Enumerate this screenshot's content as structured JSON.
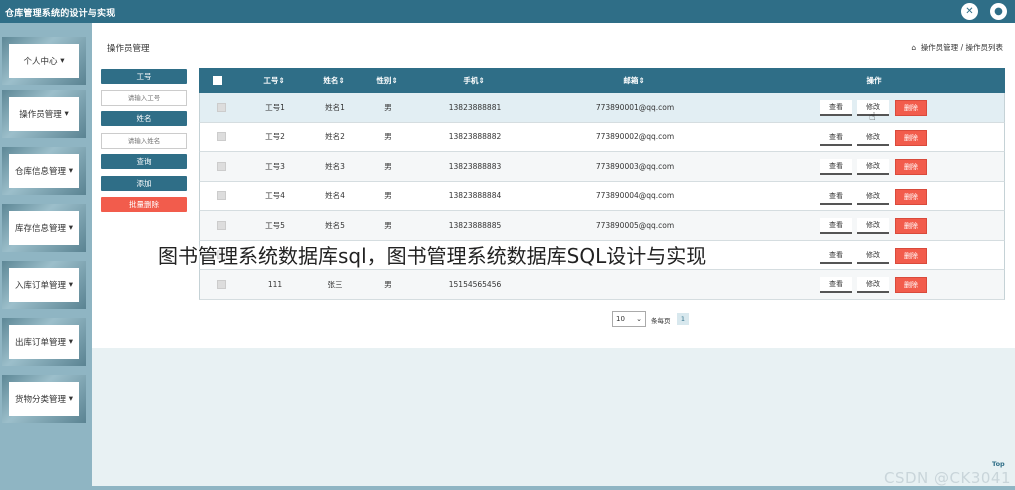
{
  "app": {
    "title": "仓库管理系统的设计与实现"
  },
  "header": {
    "icons": [
      "close-x-icon",
      "user-icon"
    ]
  },
  "sidebar": {
    "items": [
      {
        "label": "个人中心"
      },
      {
        "label": "操作员管理"
      },
      {
        "label": "仓库信息管理"
      },
      {
        "label": "库存信息管理"
      },
      {
        "label": "入库订单管理"
      },
      {
        "label": "出库订单管理"
      },
      {
        "label": "货物分类管理"
      }
    ],
    "caret": "▾"
  },
  "page": {
    "title": "操作员管理",
    "breadcrumb": {
      "home_icon": "⌂",
      "level1": "操作员管理",
      "sep": "/",
      "level2": "操作员列表"
    }
  },
  "search": {
    "id_label": "工号",
    "id_placeholder": "请输入工号",
    "name_label": "姓名",
    "name_placeholder": "请输入姓名",
    "query_btn": "查询",
    "add_btn": "添加",
    "batch_delete_btn": "批量删除"
  },
  "table": {
    "columns": [
      "工号",
      "姓名",
      "性别",
      "手机",
      "邮箱",
      "操作"
    ],
    "sort_mark": "⇕",
    "rows": [
      {
        "id": "工号1",
        "name": "姓名1",
        "gender": "男",
        "phone": "13823888881",
        "email": "773890001@qq.com"
      },
      {
        "id": "工号2",
        "name": "姓名2",
        "gender": "男",
        "phone": "13823888882",
        "email": "773890002@qq.com"
      },
      {
        "id": "工号3",
        "name": "姓名3",
        "gender": "男",
        "phone": "13823888883",
        "email": "773890003@qq.com"
      },
      {
        "id": "工号4",
        "name": "姓名4",
        "gender": "男",
        "phone": "13823888884",
        "email": "773890004@qq.com"
      },
      {
        "id": "工号5",
        "name": "姓名5",
        "gender": "男",
        "phone": "13823888885",
        "email": "773890005@qq.com"
      },
      {
        "id": "",
        "name": "",
        "gender": "",
        "phone": "",
        "email": ""
      },
      {
        "id": "111",
        "name": "张三",
        "gender": "男",
        "phone": "15154565456",
        "email": ""
      }
    ],
    "actions": {
      "view": "查看",
      "edit": "修改",
      "delete": "删除"
    }
  },
  "pagination": {
    "page_size": "10",
    "per_page_label": "条每页",
    "current_page": "1"
  },
  "overlay": {
    "caption": "图书管理系统数据库sql，图书管理系统数据库SQL设计与实现",
    "csdn": "CSDN @CK3041",
    "top": "Top"
  },
  "colors": {
    "primary": "#2f6e87",
    "danger": "#f25c4c",
    "sidebar": "#8fb5c3"
  }
}
